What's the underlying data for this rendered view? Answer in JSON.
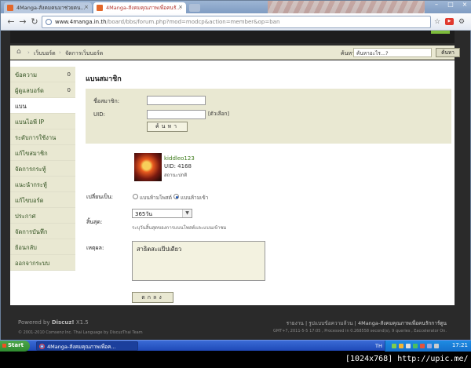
{
  "browser": {
    "tabs": [
      {
        "label": "4Manga-สังคมคนมาช่วยคน..."
      },
      {
        "label": "4Manga-สังคมคุณภาพเพื่อคนรั..."
      }
    ],
    "url_host": "www.4manga.in.th",
    "url_path": "/board/bbs/forum.php?mod=modcp&action=member&op=ban"
  },
  "crumbs": {
    "board": "เว็บบอร์ด",
    "admin": "จัดการเว็บบอร์ด"
  },
  "search": {
    "label": "ค้นหา",
    "placeholder": "ค้นหาอะไร...?",
    "button": "ค้นหา"
  },
  "sidebar": {
    "items": [
      {
        "label": "ข้อความ",
        "count": "0"
      },
      {
        "label": "ผู้ดูแลบอร์ด",
        "count": "0"
      },
      {
        "label": "แบน",
        "count": ""
      },
      {
        "label": "แบนไอพี IP",
        "count": ""
      },
      {
        "label": "ระดับการใช้งาน",
        "count": ""
      },
      {
        "label": "แก้ไขสมาชิก",
        "count": ""
      },
      {
        "label": "จัดการกระทู้",
        "count": ""
      },
      {
        "label": "แนะนำกระทู้",
        "count": ""
      },
      {
        "label": "แก้ไขบอร์ด",
        "count": ""
      },
      {
        "label": "ประกาศ",
        "count": ""
      },
      {
        "label": "จัดการบันทึก",
        "count": ""
      },
      {
        "label": "ย้อนกลับ",
        "count": ""
      },
      {
        "label": "ออกจากระบบ",
        "count": ""
      }
    ]
  },
  "main": {
    "title": "แบนสมาชิก",
    "member_label": "ชื่อสมาชิก:",
    "uid_label": "UID:",
    "uid_pick": "[ตัวเลือก]",
    "search_button": "ค้นหา",
    "user": {
      "name": "kiddleo123",
      "uid": "UID: 4168",
      "status": "สถานะปกติ"
    },
    "change_label": "เปลี่ยนเป็น:",
    "option_unban": "แบนห้ามโพสต์",
    "option_ban": "แบนห้ามเข้า",
    "expire_label": "สิ้นสุด:",
    "expire_value": "365วัน",
    "expire_hint": "ระบุวันสิ้นสุดของการแบนโพสต์และแบนเข้าชม",
    "reason_label": "เหตุผล:",
    "reason_value": "สาธิตสะแป๊ปเดียว",
    "submit": "ตกลง"
  },
  "footer": {
    "powered_prefix": "Powered by",
    "powered_name": "Discuz!",
    "powered_version": "X1.5",
    "copyright": "© 2001-2010 Comsenz Inc. Thai Language by DiscuzThai Team",
    "links": "รายงาน | รูปแบบข้อความล้วน |",
    "sitename": "4Manga-สังคมคุณภาพเพื่อคนรักการ์ตูน",
    "gmt": "GMT+7, 2011-5-5 17:05 , Processed in 0.268558 second(s), 9 queries , Eaccelerator On."
  },
  "taskbar": {
    "start": "Start",
    "item": "4Manga-สังคมคุณภาพเพื่อค...",
    "lang": "TH",
    "clock": "17:21"
  },
  "watermark": "[1024x768] http://upic.me/"
}
